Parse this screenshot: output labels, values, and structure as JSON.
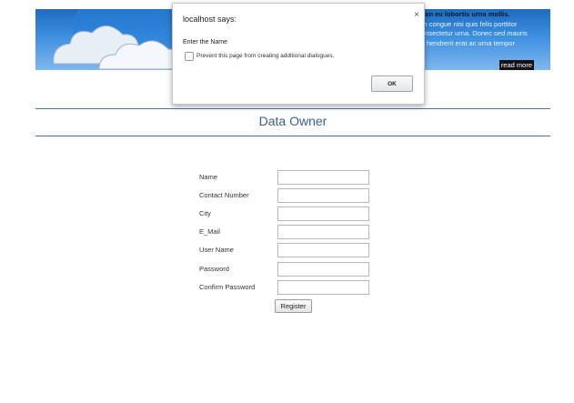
{
  "banner": {
    "line1": "san eu lobortis urna mollis.",
    "line2": "rn congue nisi quis felis porttitor",
    "line3": "onsectetur urna. Donec sed mauris",
    "line4": "s hendrerit erat ac urna tempor",
    "read_more": "read more"
  },
  "dialog": {
    "title": "localhost says:",
    "close_glyph": "×",
    "message": "Enter the Name",
    "checkbox_label": "Prevent this page from creating additional dialogues.",
    "ok_label": "OK"
  },
  "page": {
    "title": "Data Owner"
  },
  "form": {
    "fields": [
      {
        "label": "Name",
        "value": ""
      },
      {
        "label": "Contact Number",
        "value": ""
      },
      {
        "label": "City",
        "value": ""
      },
      {
        "label": "E_Mail",
        "value": ""
      },
      {
        "label": "User Name",
        "value": ""
      },
      {
        "label": "Password",
        "value": ""
      },
      {
        "label": "Confirm Password",
        "value": ""
      }
    ],
    "submit_label": "Register"
  },
  "colors": {
    "banner_blue": "#1e6bbf",
    "title_blue": "#3a5f8e",
    "rule_blue": "#4a74a6"
  }
}
